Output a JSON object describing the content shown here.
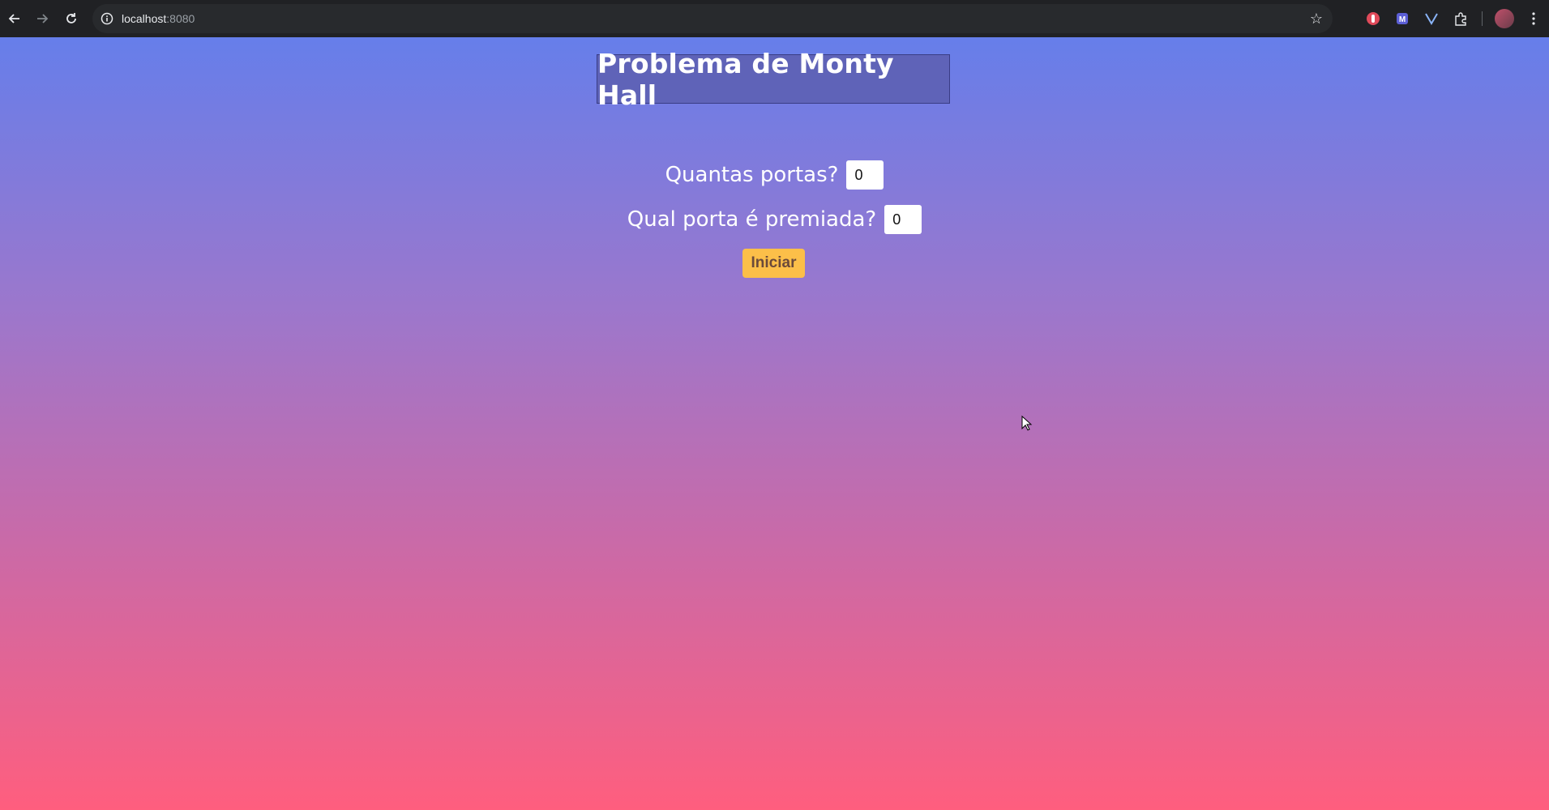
{
  "browser": {
    "url_host": "localhost",
    "url_port": ":8080",
    "back_icon": "arrow-left-icon",
    "forward_icon": "arrow-right-icon",
    "reload_icon": "reload-icon",
    "bookmark_icon": "star-icon"
  },
  "page": {
    "title": "Problema de Monty Hall",
    "doors_label": "Quantas portas?",
    "doors_value": "0",
    "prize_label": "Qual porta é premiada?",
    "prize_value": "0",
    "start_button": "Iniciar"
  },
  "colors": {
    "gradient_top": "#667eea",
    "gradient_bottom": "#ff5e7e",
    "title_box": "#5f63b8",
    "button": "#fcbf49"
  }
}
